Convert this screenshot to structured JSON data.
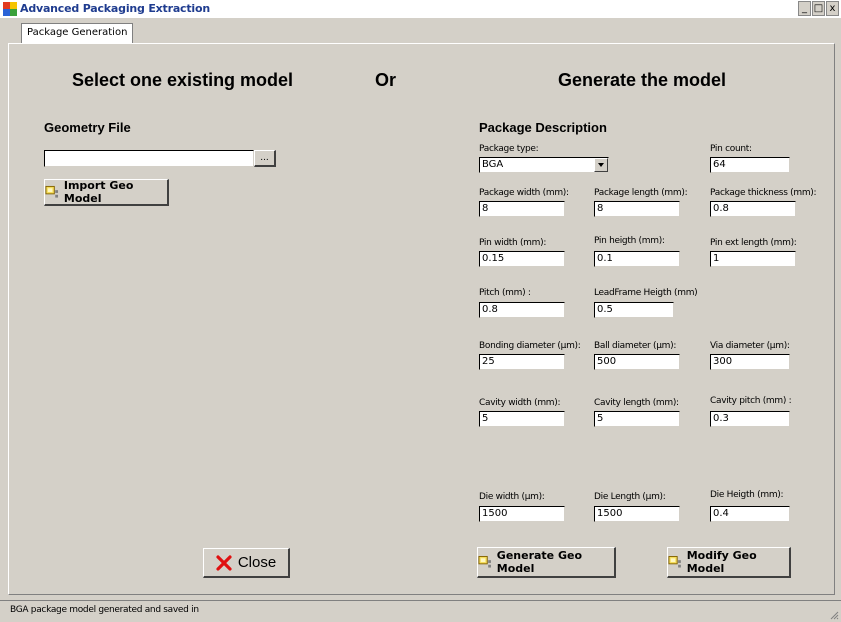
{
  "window": {
    "title": "Advanced Packaging Extraction",
    "min": "_",
    "max": "□",
    "close": "x"
  },
  "tabs": [
    {
      "label": "Package Generation"
    }
  ],
  "left": {
    "heading": "Select one existing model",
    "geometry_file_label": "Geometry File",
    "geometry_file_value": "",
    "browse_label": "...",
    "import_button": "Import Geo Model",
    "close_button": "Close"
  },
  "or_label": "Or",
  "right": {
    "heading": "Generate the model",
    "section_label": "Package Description",
    "fields": {
      "package_type": {
        "label": "Package type:",
        "value": "BGA"
      },
      "pin_count": {
        "label": "Pin count:",
        "value": "64"
      },
      "package_width": {
        "label": "Package width (mm):",
        "value": "8"
      },
      "package_length": {
        "label": "Package length (mm):",
        "value": "8"
      },
      "package_thickness": {
        "label": "Package thickness (mm):",
        "value": "0.8"
      },
      "pin_width": {
        "label": "Pin width (mm):",
        "value": "0.15"
      },
      "pin_height": {
        "label": "Pin heigth (mm):",
        "value": "0.1"
      },
      "pin_ext_length": {
        "label": "Pin ext length (mm):",
        "value": "1"
      },
      "pitch": {
        "label": "Pitch (mm) :",
        "value": "0.8"
      },
      "leadframe_height": {
        "label": "LeadFrame Heigth (mm)",
        "value": "0.5"
      },
      "bonding_diameter": {
        "label": "Bonding diameter (µm):",
        "value": "25"
      },
      "ball_diameter": {
        "label": "Ball diameter (µm):",
        "value": "500"
      },
      "via_diameter": {
        "label": "Via diameter (µm):",
        "value": "300"
      },
      "cavity_width": {
        "label": "Cavity width (mm):",
        "value": "5"
      },
      "cavity_length": {
        "label": "Cavity length (mm):",
        "value": "5"
      },
      "cavity_pitch": {
        "label": "Cavity pitch (mm) :",
        "value": "0.3"
      },
      "die_width": {
        "label": "Die width (µm):",
        "value": "1500"
      },
      "die_length": {
        "label": "Die Length (µm):",
        "value": "1500"
      },
      "die_height": {
        "label": "Die Heigth (mm):",
        "value": "0.4"
      }
    },
    "generate_button": "Generate Geo Model",
    "modify_button": "Modify Geo Model"
  },
  "status": {
    "text": "BGA package model generated and saved in"
  },
  "colors": {
    "background": "#d4d0c8",
    "title_text": "#1f3c8f",
    "close_x": "#e01010"
  }
}
